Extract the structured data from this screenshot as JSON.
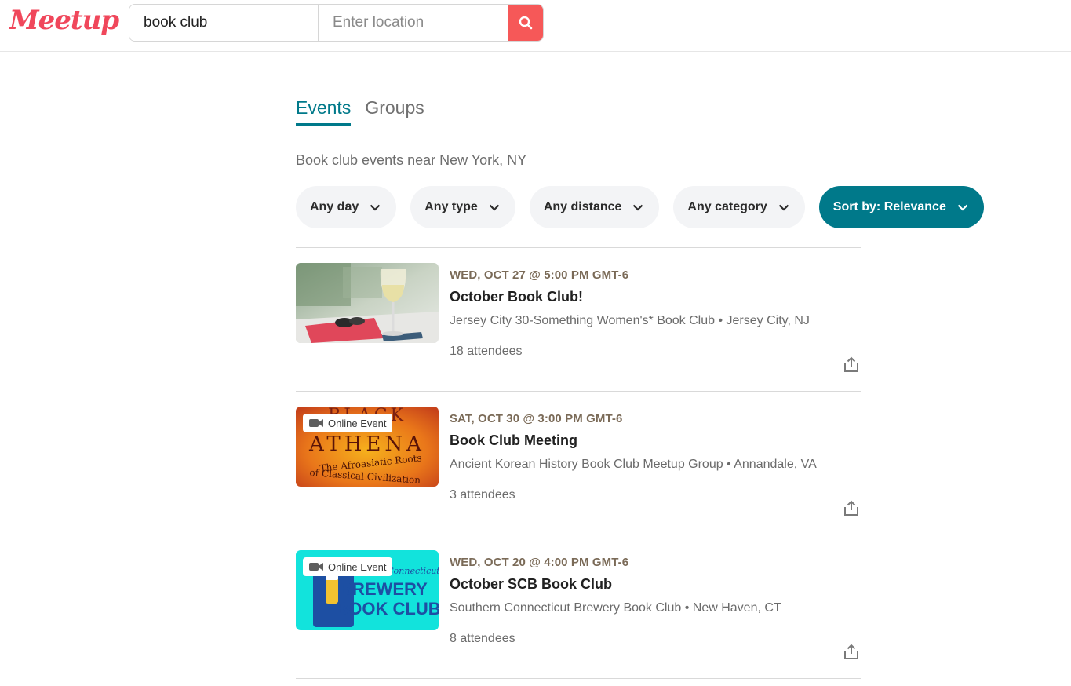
{
  "header": {
    "logo": "Meetup",
    "search_value": "book club",
    "location_placeholder": "Enter location"
  },
  "tabs": [
    {
      "label": "Events",
      "active": true
    },
    {
      "label": "Groups",
      "active": false
    }
  ],
  "subtitle": "Book club events near New York, NY",
  "filters": [
    {
      "label": "Any day"
    },
    {
      "label": "Any type"
    },
    {
      "label": "Any distance"
    },
    {
      "label": "Any category"
    },
    {
      "label": "Sort by: Relevance"
    }
  ],
  "events": [
    {
      "date": "WED, OCT 27 @ 5:00 PM GMT-6",
      "title": "October Book Club!",
      "group": "Jersey City 30-Something Women's* Book Club • Jersey City, NJ",
      "attendees": "18 attendees",
      "online": false
    },
    {
      "date": "SAT, OCT 30 @ 3:00 PM GMT-6",
      "title": "Book Club Meeting",
      "group": "Ancient Korean History Book Club Meetup Group • Annandale, VA",
      "attendees": "3 attendees",
      "online": true,
      "badge": "Online Event",
      "thumb_text": {
        "top": "BLACK",
        "mid": "ATHENA",
        "sub1": "The Afroasiatic Roots",
        "sub2": "of Classical Civilization"
      }
    },
    {
      "date": "WED, OCT 20 @ 4:00 PM GMT-6",
      "title": "October SCB Book Club",
      "group": "Southern Connecticut Brewery Book Club • New Haven, CT",
      "attendees": "8 attendees",
      "online": true,
      "badge": "Online Event",
      "thumb_text": {
        "script": "Connecticut",
        "line1": "BREWERY",
        "line2": "BOOK CLUB"
      }
    }
  ],
  "colors": {
    "brand": "#f65858",
    "accent": "#00798a",
    "date": "#7a6a57"
  }
}
